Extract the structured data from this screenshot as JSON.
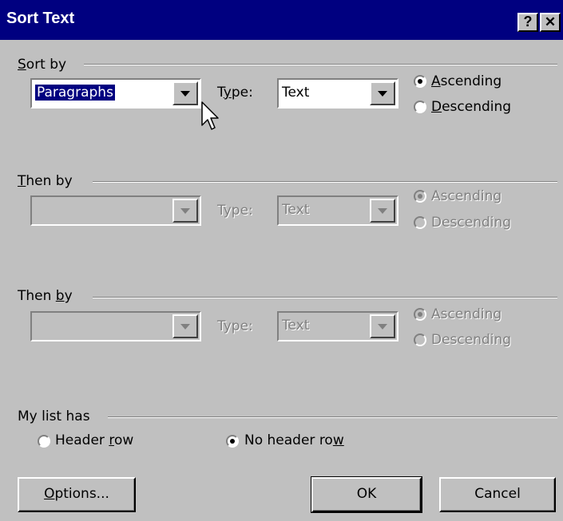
{
  "window": {
    "title": "Sort Text",
    "help_button": "?",
    "close_button": "✕"
  },
  "sort_by": {
    "group_pre": "",
    "group_u": "S",
    "group_post": "ort by",
    "field_value": "Paragraphs",
    "type_pre": "T",
    "type_u": "y",
    "type_post": "pe:",
    "type_value": "Text",
    "asc_u": "A",
    "asc_post": "scending",
    "desc_u": "D",
    "desc_post": "escending",
    "order": "ascending"
  },
  "then_by_1": {
    "group_u": "T",
    "group_post": "hen by",
    "field_value": "",
    "type_label": "Type:",
    "type_value": "Text",
    "asc_label": "Ascending",
    "desc_label": "Descending",
    "order": "ascending"
  },
  "then_by_2": {
    "group_pre": "Then ",
    "group_u": "b",
    "group_post": "y",
    "field_value": "",
    "type_label": "Type:",
    "type_value": "Text",
    "asc_label": "Ascending",
    "desc_label": "Descending",
    "order": "ascending"
  },
  "list_has": {
    "group_label": "My list has",
    "header_pre": "Header ",
    "header_u": "r",
    "header_post": "ow",
    "noheader_pre": "No header ro",
    "noheader_u": "w",
    "selected": "no header row"
  },
  "buttons": {
    "options_u": "O",
    "options_post": "ptions...",
    "ok": "OK",
    "cancel": "Cancel"
  },
  "colors": {
    "face": "#c0c0c0",
    "title_bar": "#000080",
    "disabled_text": "#808080"
  },
  "icons": [
    "help-icon",
    "close-icon",
    "dropdown-arrow-icon",
    "mouse-cursor-icon"
  ]
}
